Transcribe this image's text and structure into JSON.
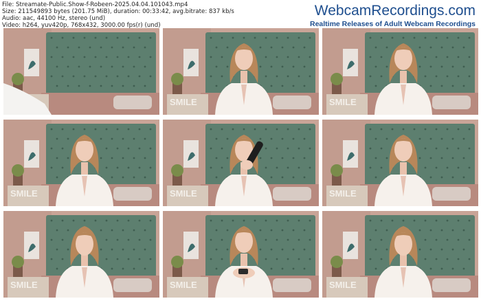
{
  "meta": {
    "file": "File: Streamate-Public.Show-f-Robeen-2025.04.04.101043.mp4",
    "size": "Size: 211549893 bytes (201.75 MiB), duration: 00:33:42, avg.bitrate: 837 kb/s",
    "audio": "Audio: aac, 44100 Hz, stereo (und)",
    "video": "Video: h264, yuv420p, 768x432, 3000.00 fps(r) (und)"
  },
  "brand": {
    "name": "WebcamRecordings.com",
    "tagline": "Realtime Releases of Adult Webcam Recordings"
  },
  "thumbnails": [
    {
      "pose": "empty"
    },
    {
      "pose": "talk"
    },
    {
      "pose": "talk"
    },
    {
      "pose": "talk"
    },
    {
      "pose": "drink"
    },
    {
      "pose": "talk"
    },
    {
      "pose": "look-down"
    },
    {
      "pose": "hands"
    },
    {
      "pose": "look-down"
    }
  ],
  "sign_text": "SMILE"
}
